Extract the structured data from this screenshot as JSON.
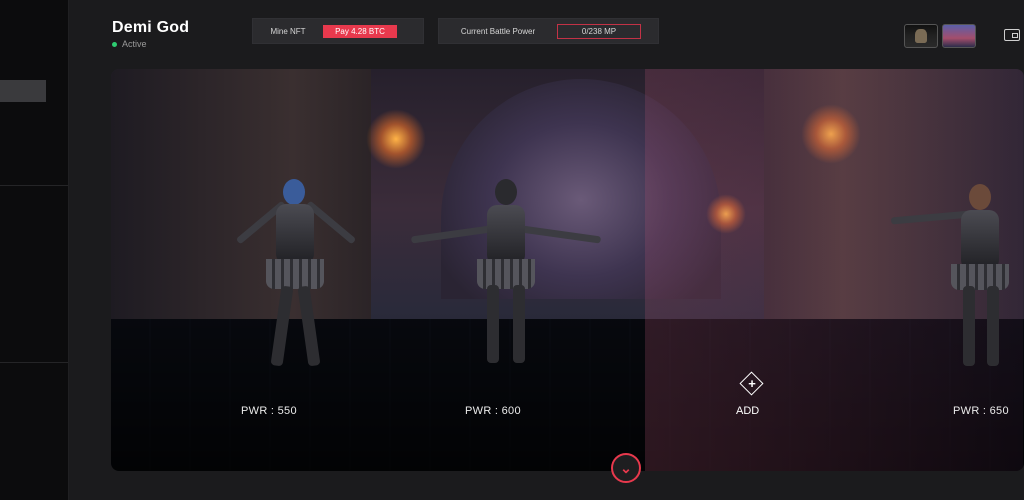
{
  "profile": {
    "name": "Demi God",
    "status": "Active"
  },
  "header": {
    "mine_label": "Mine NFT",
    "mine_value": "Pay 4.28 BTC",
    "power_label": "Current Battle Power",
    "power_value": "0/238 MP"
  },
  "heroes": [
    {
      "power": "PWR : 550"
    },
    {
      "power": "PWR : 600"
    },
    {
      "power": "PWR : 650"
    }
  ],
  "add": {
    "label": "ADD",
    "icon": "plus-diamond-icon"
  },
  "icons": [
    "wallet-icon",
    "chevron-double-down-icon"
  ],
  "colors": {
    "accent": "#e8394d",
    "status": "#2ecc71",
    "background": "#1b1b1d"
  }
}
